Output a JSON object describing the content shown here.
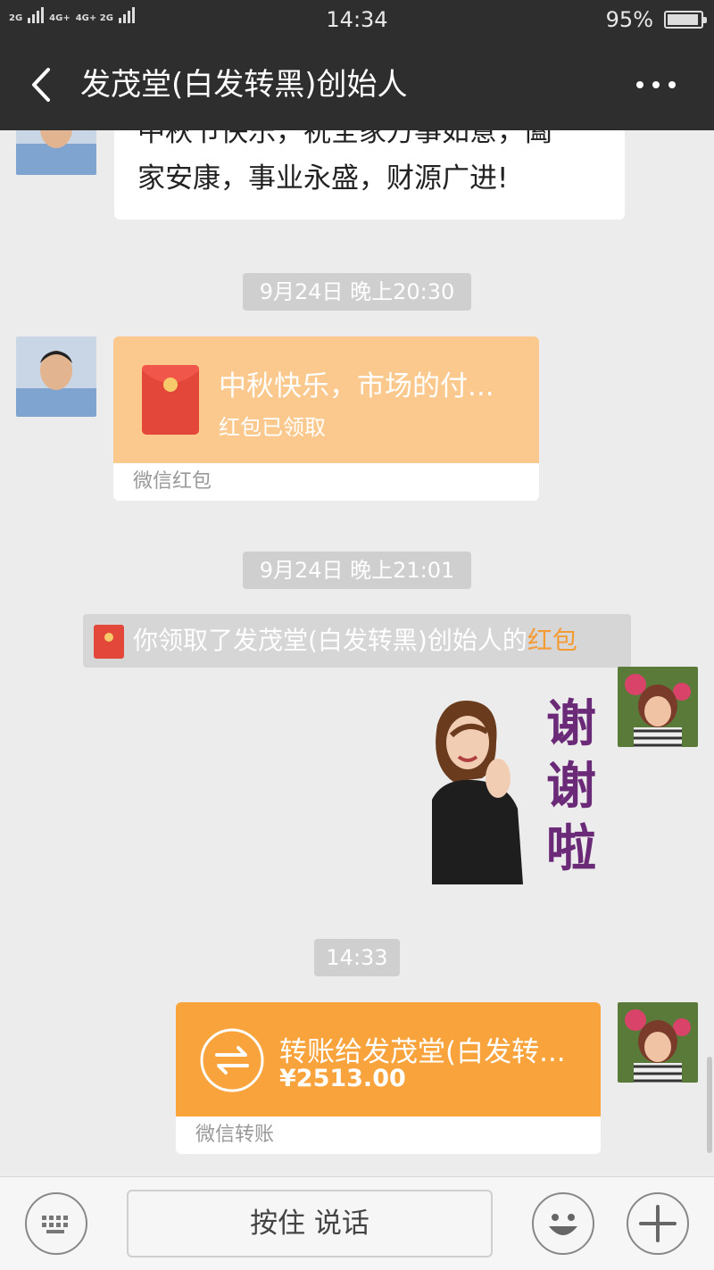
{
  "status": {
    "network_left": "2G",
    "network_mid": "4G+",
    "network_mid2": "4G+ 2G",
    "time": "14:34",
    "battery": "95%",
    "battery_level": 0.95
  },
  "header": {
    "title": "发茂堂(白发转黑)创始人",
    "back_icon": "chevron-left-icon",
    "more_icon": "more-dots-icon"
  },
  "messages": {
    "text1": {
      "line1": "中秋节快乐，祝全家万事如意，阖",
      "line2": "家安康，事业永盛，财源广进!"
    },
    "time1": "9月24日 晚上20:30",
    "red_packet": {
      "title": "中秋快乐，市场的付...",
      "status": "红包已领取",
      "footer": "微信红包"
    },
    "time2": "9月24日 晚上21:01",
    "system": {
      "text": "你领取了发茂堂(白发转黑)创始人的",
      "link": "红包"
    },
    "sticker": {
      "chars": [
        "谢",
        "谢",
        "啦"
      ]
    },
    "time3": "14:33",
    "transfer": {
      "title": "转账给发茂堂(白发转...",
      "amount": "¥2513.00",
      "footer": "微信转账"
    }
  },
  "input": {
    "hold_to_talk": "按住 说话",
    "keyboard_icon": "keyboard-icon",
    "emoji_icon": "emoji-icon",
    "plus_icon": "plus-icon"
  },
  "colors": {
    "header_bg": "#2e2e2e",
    "chat_bg": "#ececec",
    "red_packet_light": "#fbc98d",
    "transfer_orange": "#f9a33d",
    "accent": "#f59b34"
  }
}
